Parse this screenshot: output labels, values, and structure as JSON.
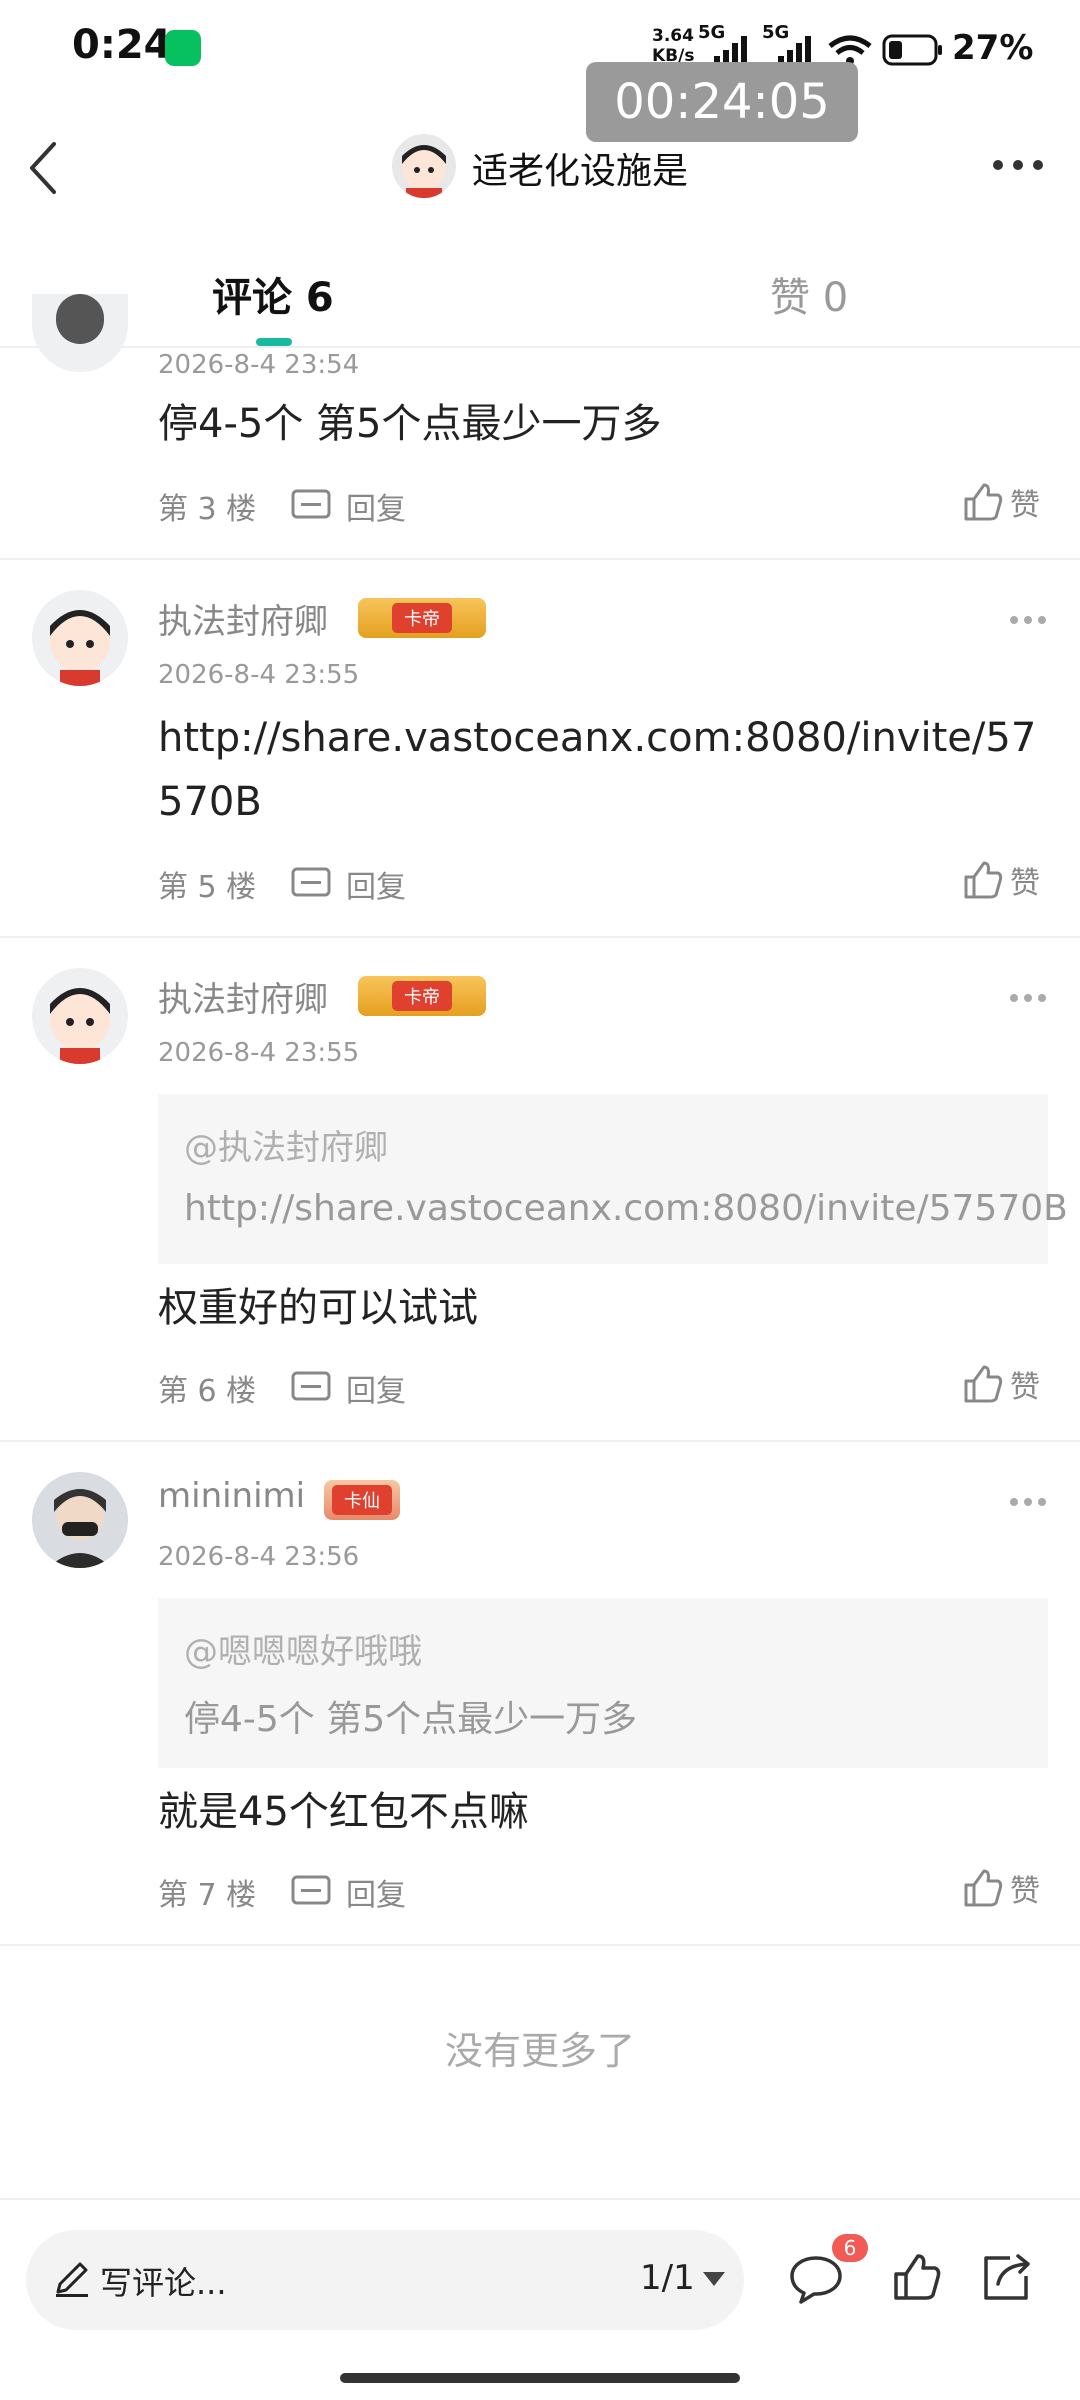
{
  "status_bar": {
    "time": "0:24",
    "net_speed": "3.64 KB/s",
    "net_type_1": "5G",
    "net_type_2": "5G",
    "battery": "27%"
  },
  "timer": "00:24:05",
  "header": {
    "title": "适老化设施是"
  },
  "tabs": {
    "comments": "评论 6",
    "likes": "赞 0"
  },
  "comments": [
    {
      "timestamp": "2026-8-4 23:54",
      "content": "停4-5个 第5个点最少一万多",
      "floor": "第 3 楼",
      "reply": "回复",
      "like": "赞"
    },
    {
      "username": "执法封府卿",
      "badge": "卡帝",
      "timestamp": "2026-8-4 23:55",
      "content": "http://share.vastoceanx.com:8080/invite/57570B",
      "floor": "第 5 楼",
      "reply": "回复",
      "like": "赞"
    },
    {
      "username": "执法封府卿",
      "badge": "卡帝",
      "timestamp": "2026-8-4 23:55",
      "quote_user": "@执法封府卿",
      "quote_text": "http://share.vastoceanx.com:8080/invite/57570B",
      "content": "权重好的可以试试",
      "floor": "第 6 楼",
      "reply": "回复",
      "like": "赞"
    },
    {
      "username": "mininimi",
      "badge": "卡仙",
      "timestamp": "2026-8-4 23:56",
      "quote_user": "@嗯嗯嗯好哦哦",
      "quote_text": "停4-5个 第5个点最少一万多",
      "content": "就是45个红包不点嘛",
      "floor": "第 7 楼",
      "reply": "回复",
      "like": "赞"
    }
  ],
  "footer_note": "没有更多了",
  "bottom_bar": {
    "placeholder": "写评论...",
    "page": "1/1",
    "comment_count": "6"
  },
  "colors": {
    "accent": "#18b9a0",
    "badge_red": "#f25a55"
  }
}
